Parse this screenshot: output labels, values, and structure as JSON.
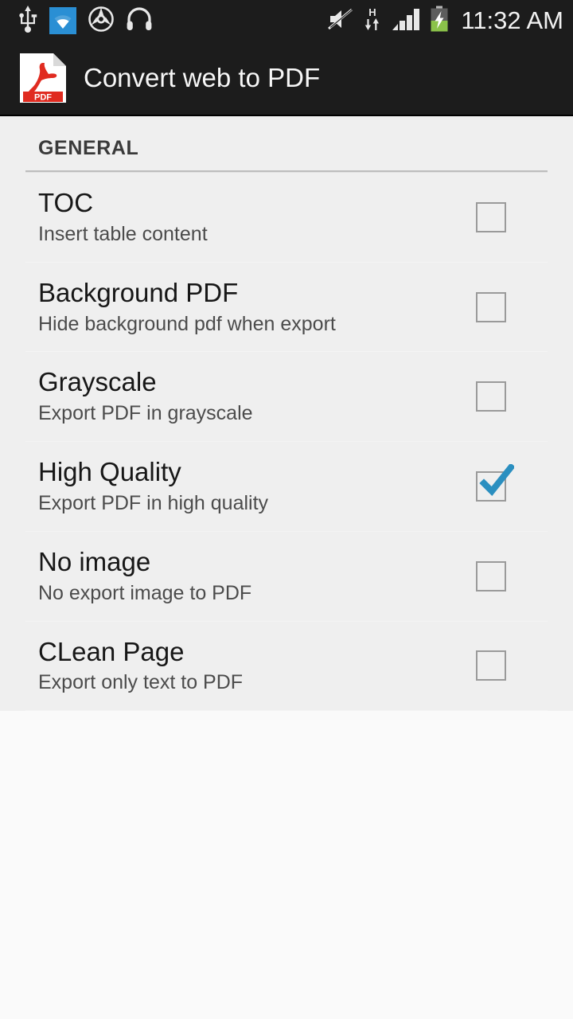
{
  "status_bar": {
    "background_color": "#1c1c1c",
    "clock": "11:32 AM",
    "left_icons": [
      {
        "name": "usb-icon",
        "label": "USB connected"
      },
      {
        "name": "wifi-icon",
        "label": "Wi-Fi connected",
        "highlight_color": "#2a8fd4"
      },
      {
        "name": "car-mode-icon",
        "label": "Driving mode"
      },
      {
        "name": "headphones-icon",
        "label": "Headphones connected"
      }
    ],
    "right_icons": [
      {
        "name": "mute-icon",
        "label": "Sound muted"
      },
      {
        "name": "hspa-data-icon",
        "label": "H",
        "sublabel": "data transfer"
      },
      {
        "name": "signal-bars-icon",
        "label": "Signal strength",
        "bars": 4
      },
      {
        "name": "battery-charging-icon",
        "label": "Battery charging",
        "color": "#8bc34a"
      }
    ]
  },
  "action_bar": {
    "icon_name": "pdf-file-icon",
    "icon_label": "PDF",
    "icon_color": "#e02b20",
    "title": "Convert web to PDF"
  },
  "content": {
    "section": {
      "title": "GENERAL"
    },
    "preferences": [
      {
        "key": "toc",
        "title": "TOC",
        "summary": "Insert table content",
        "checked": false
      },
      {
        "key": "background-pdf",
        "title": "Background PDF",
        "summary": "Hide background pdf when export",
        "checked": false
      },
      {
        "key": "grayscale",
        "title": "Grayscale",
        "summary": "Export PDF in grayscale",
        "checked": false
      },
      {
        "key": "high-quality",
        "title": "High Quality",
        "summary": "Export PDF in high quality",
        "checked": true
      },
      {
        "key": "no-image",
        "title": "No image",
        "summary": "No export image to PDF",
        "checked": false
      },
      {
        "key": "clean-page",
        "title": "CLean Page",
        "summary": "Export only text to PDF",
        "checked": false
      }
    ],
    "checkbox_checked_color": "#2b8fc0",
    "checkbox_border_color": "#9a9a9a",
    "list_background_color": "#efefef",
    "page_background_color": "#fafafa"
  }
}
